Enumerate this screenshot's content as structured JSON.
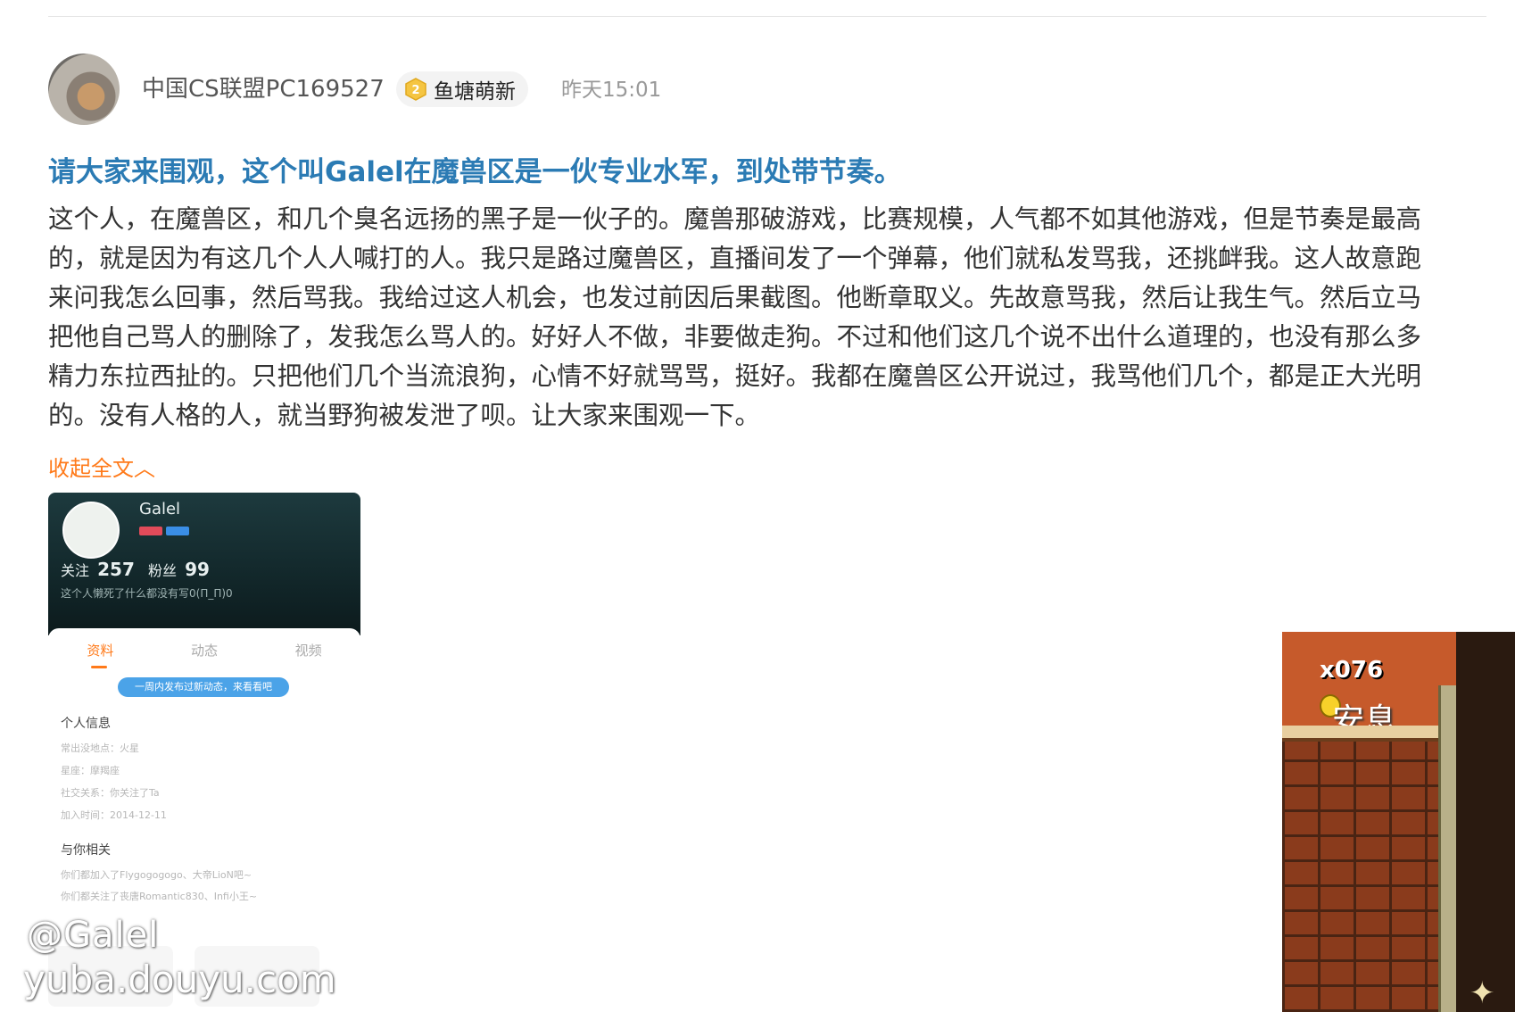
{
  "post": {
    "username": "中国CS联盟PC169527",
    "badge": {
      "level": "2",
      "label": "鱼塘萌新",
      "icon": "level-badge-icon"
    },
    "time": "昨天15:01",
    "title": "请大家来围观，这个叫Galel在魔兽区是一伙专业水军，到处带节奏。",
    "content": "这个人，在魔兽区，和几个臭名远扬的黑子是一伙子的。魔兽那破游戏，比赛规模，人气都不如其他游戏，但是节奏是最高的，就是因为有这几个人人喊打的人。我只是路过魔兽区，直播间发了一个弹幕，他们就私发骂我，还挑衅我。这人故意跑来问我怎么回事，然后骂我。我给过这人机会，也发过前因后果截图。他断章取义。先故意骂我，然后让我生气。然后立马把他自己骂人的删除了，发我怎么骂人的。好好人不做，非要做走狗。不过和他们这几个说不出什么道理的，也没有那么多精力东拉西扯的。只把他们几个当流浪狗，心情不好就骂骂，挺好。我都在魔兽区公开说过，我骂他们几个，都是正大光明的。没有人格的人，就当野狗被发泄了呗。让大家来围观一下。",
    "collapse_label": "收起全文︿"
  },
  "screenshot": {
    "name": "Galel",
    "follow_label": "关注",
    "follow_count": "257",
    "fans_label": "粉丝",
    "fans_count": "99",
    "signature": "这个人懒死了什么都没有写0(Π_Π)0",
    "tabs": [
      "资料",
      "动态",
      "视频"
    ],
    "active_tab": "资料",
    "notice": "一周内发布过新动态，来看看吧",
    "info_title": "个人信息",
    "info_lines": [
      "常出没地点：火星",
      "星座：摩羯座",
      "社交关系：你关注了Ta",
      "加入时间：2014-12-11"
    ],
    "related_title": "与你相关",
    "related_lines": [
      "你们都加入了Flygogogogo、大帝LioN吧~",
      "你们都关注了丧唐Romantic830、Infi小王~"
    ]
  },
  "watermark": {
    "line1": "@Galel",
    "line2": "yuba.douyu.com"
  },
  "game_overlay": {
    "lives": "x076",
    "rest_text": "安息"
  },
  "colors": {
    "title": "#2b7bb4",
    "accent": "#ff7a1a",
    "text": "#333333",
    "muted": "#999999"
  }
}
